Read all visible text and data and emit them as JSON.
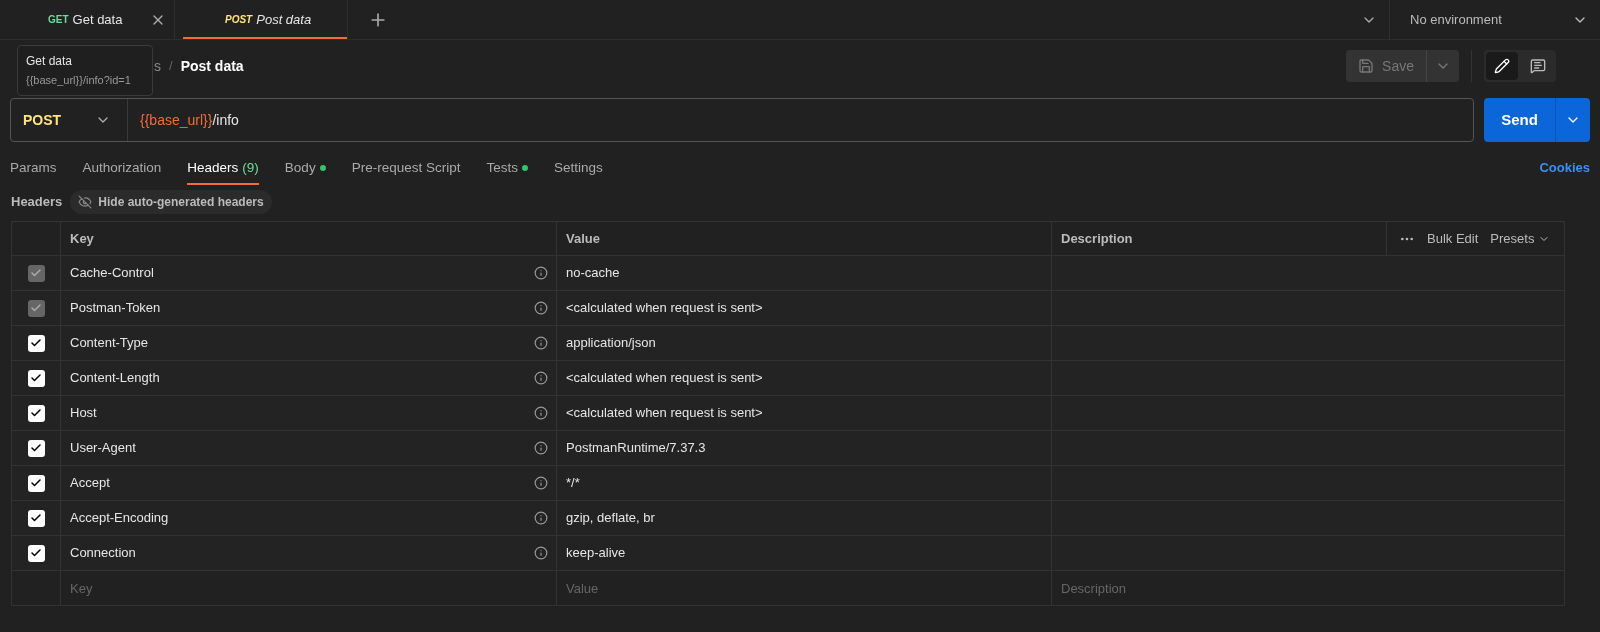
{
  "tabs": [
    {
      "method": "GET",
      "title": "Get data",
      "selected": false
    },
    {
      "method": "POST",
      "title": "Post data",
      "selected": true
    }
  ],
  "environment": "No environment",
  "tooltip": {
    "title": "Get data",
    "url": "{{base_url}}/info?id=1"
  },
  "breadcrumb": [
    "s",
    "Post data"
  ],
  "breadcrumb_separator": "/",
  "save_button": "Save",
  "request": {
    "method": "POST",
    "url_variable": "{{base_url}}",
    "url_path": "/info"
  },
  "send_button": "Send",
  "request_tabs": [
    {
      "label": "Params",
      "selected": false
    },
    {
      "label": "Authorization",
      "selected": false
    },
    {
      "label": "Headers",
      "count": "(9)",
      "selected": true
    },
    {
      "label": "Body",
      "dot": true,
      "selected": false
    },
    {
      "label": "Pre-request Script",
      "selected": false
    },
    {
      "label": "Tests",
      "dot": true,
      "selected": false
    },
    {
      "label": "Settings",
      "selected": false
    }
  ],
  "cookies_link": "Cookies",
  "headers_label": "Headers",
  "hide_button": "Hide auto-generated headers",
  "table": {
    "columns": [
      "Key",
      "Value",
      "Description"
    ],
    "bulk_edit": "Bulk Edit",
    "presets": "Presets",
    "rows": [
      {
        "key": "Cache-Control",
        "value": "no-cache",
        "checked": true,
        "disabled": true
      },
      {
        "key": "Postman-Token",
        "value": "<calculated when request is sent>",
        "checked": true,
        "disabled": true
      },
      {
        "key": "Content-Type",
        "value": "application/json",
        "checked": true,
        "disabled": false
      },
      {
        "key": "Content-Length",
        "value": "<calculated when request is sent>",
        "checked": true,
        "disabled": false
      },
      {
        "key": "Host",
        "value": "<calculated when request is sent>",
        "checked": true,
        "disabled": false
      },
      {
        "key": "User-Agent",
        "value": "PostmanRuntime/7.37.3",
        "checked": true,
        "disabled": false
      },
      {
        "key": "Accept",
        "value": "*/*",
        "checked": true,
        "disabled": false
      },
      {
        "key": "Accept-Encoding",
        "value": "gzip, deflate, br",
        "checked": true,
        "disabled": false
      },
      {
        "key": "Connection",
        "value": "keep-alive",
        "checked": true,
        "disabled": false
      }
    ],
    "new_row": {
      "key": {
        "placeholder": "Key"
      },
      "value": {
        "placeholder": "Value"
      },
      "description": {
        "placeholder": "Description"
      }
    }
  }
}
